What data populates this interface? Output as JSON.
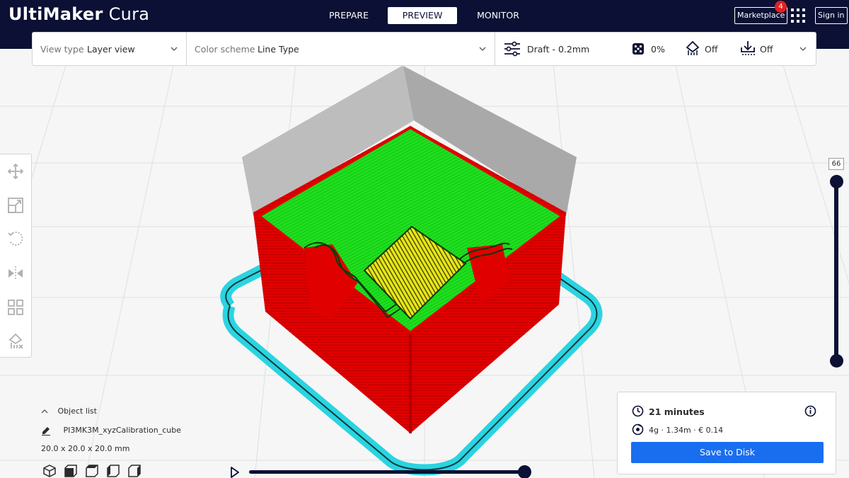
{
  "app": {
    "logo_bold": "UltiMaker",
    "logo_light": "Cura"
  },
  "header": {
    "tabs": [
      {
        "label": "PREPARE",
        "active": false
      },
      {
        "label": "PREVIEW",
        "active": true
      },
      {
        "label": "MONITOR",
        "active": false
      }
    ],
    "marketplace_label": "Marketplace",
    "marketplace_badge": "4",
    "apps_icon": "grid-apps-icon",
    "signin_label": "Sign in"
  },
  "toolbar": {
    "view_type_label": "View type",
    "view_type_value": "Layer view",
    "color_scheme_label": "Color scheme",
    "color_scheme_value": "Line Type",
    "profile": "Draft - 0.2mm",
    "infill": "0%",
    "support": "Off",
    "adhesion": "Off"
  },
  "layer_slider": {
    "current_layer": "66"
  },
  "object_list": {
    "title": "Object list",
    "object_name": "PI3MK3M_xyzCalibration_cube",
    "dimensions": "20.0 x 20.0 x 20.0 mm"
  },
  "print_info": {
    "time": "21 minutes",
    "material": "4g · 1.34m · € 0.14",
    "save_label": "Save to Disk"
  },
  "colors": {
    "header": "#0b1034",
    "accent_blue": "#196ef0",
    "wall_red": "#e00000",
    "skin_green": "#1ee01e",
    "infill_yellow": "#e6e617",
    "skirt_cyan": "#2ad4e0",
    "ghost_gray": "#bdbdbd"
  }
}
